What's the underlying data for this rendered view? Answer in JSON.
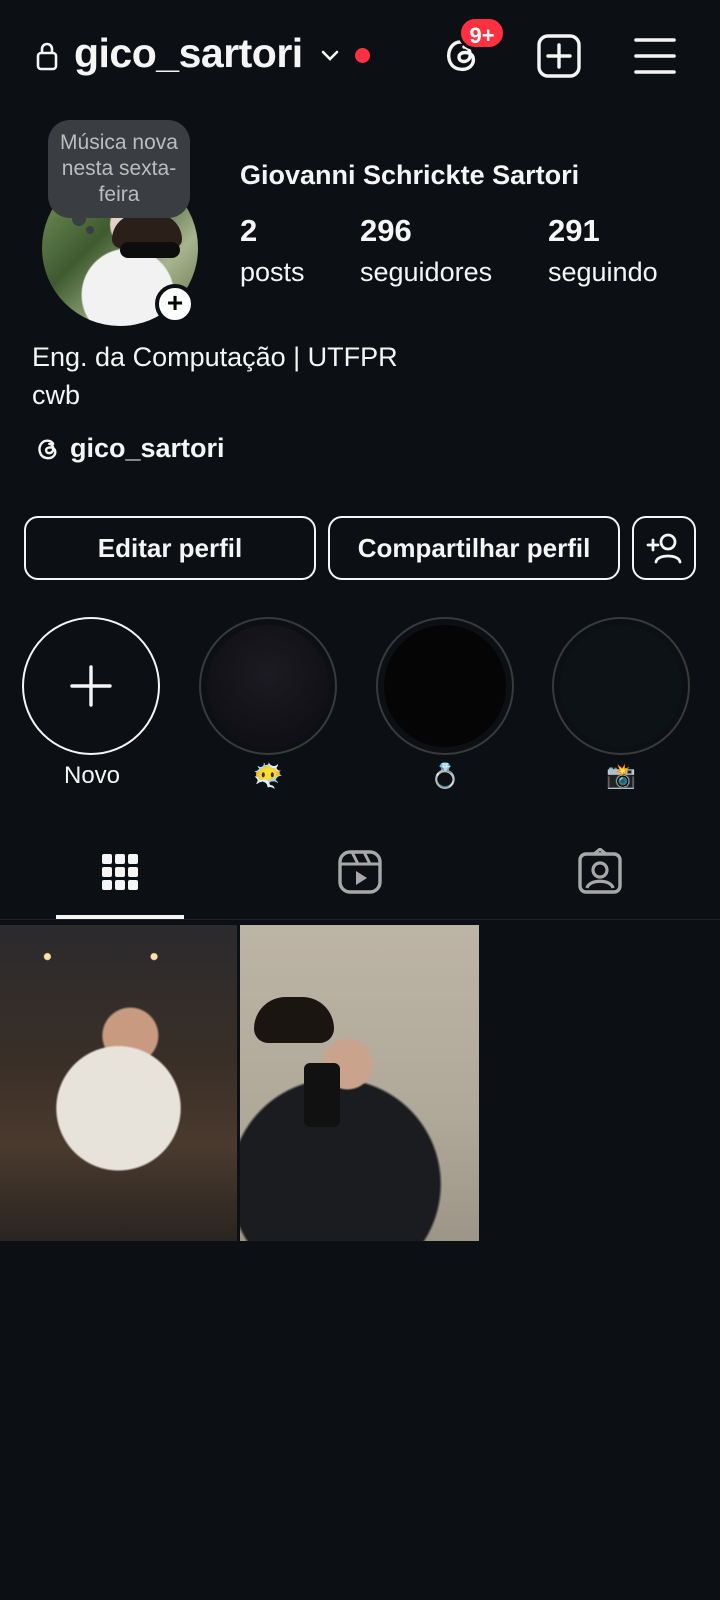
{
  "header": {
    "username": "gico_sartori",
    "notification_badge": "9+",
    "icons": [
      "lock-icon",
      "chevron-down-icon",
      "threads-icon",
      "new-post-icon",
      "menu-icon"
    ],
    "online_dot_color": "#ff3040"
  },
  "profile": {
    "note": "Música nova nesta sexta-feira",
    "full_name": "Giovanni Schrickte Sartori",
    "stats": {
      "posts": {
        "value": "2",
        "label": "posts"
      },
      "followers": {
        "value": "296",
        "label": "seguidores"
      },
      "following": {
        "value": "291",
        "label": "seguindo"
      }
    },
    "bio_line1": "Eng. da Computação | UTFPR",
    "bio_line2": "cwb",
    "threads_handle": "gico_sartori"
  },
  "actions": {
    "edit_profile": "Editar perfil",
    "share_profile": "Compartilhar perfil"
  },
  "highlights": [
    {
      "label": "Novo"
    },
    {
      "label": "😶‍🌫️"
    },
    {
      "label": "💍"
    },
    {
      "label": "📸"
    }
  ],
  "tabs": [
    "grid-icon",
    "reels-icon",
    "tagged-icon"
  ],
  "colors": {
    "background": "#0c1014",
    "text": "#f5f5f5",
    "badge": "#ff3040"
  }
}
